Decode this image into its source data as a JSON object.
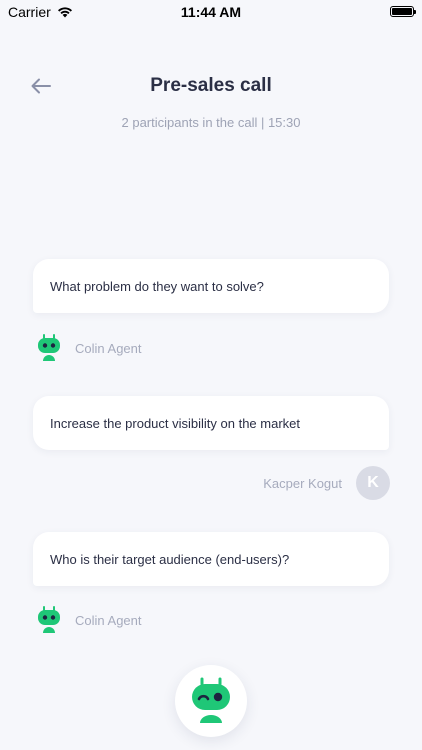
{
  "status_bar": {
    "carrier": "Carrier",
    "time": "11:44 AM",
    "wifi_icon": "wifi-icon",
    "battery_icon": "battery-icon"
  },
  "header": {
    "back_icon": "arrow-left-icon",
    "title": "Pre-sales call",
    "subtitle": "2 participants in the call | 15:30"
  },
  "messages": [
    {
      "role": "bot",
      "text": "What problem do they want to solve?",
      "sender": "Colin Agent",
      "avatar_icon": "robot-icon"
    },
    {
      "role": "user",
      "text": "Increase the product visibility on the market",
      "sender": "Kacper Kogut",
      "avatar_initial": "K"
    },
    {
      "role": "bot",
      "text": "Who is their target audience (end-users)?",
      "sender": "Colin Agent",
      "avatar_icon": "robot-icon"
    }
  ],
  "bot_button": {
    "icon": "robot-wink-icon"
  },
  "colors": {
    "background": "#f6f7fb",
    "bubble": "#ffffff",
    "text": "#2b2f45",
    "muted": "#a6abbd",
    "robot_green": "#1fc777",
    "robot_dark": "#1d2340",
    "user_avatar": "#d9dbe5"
  }
}
